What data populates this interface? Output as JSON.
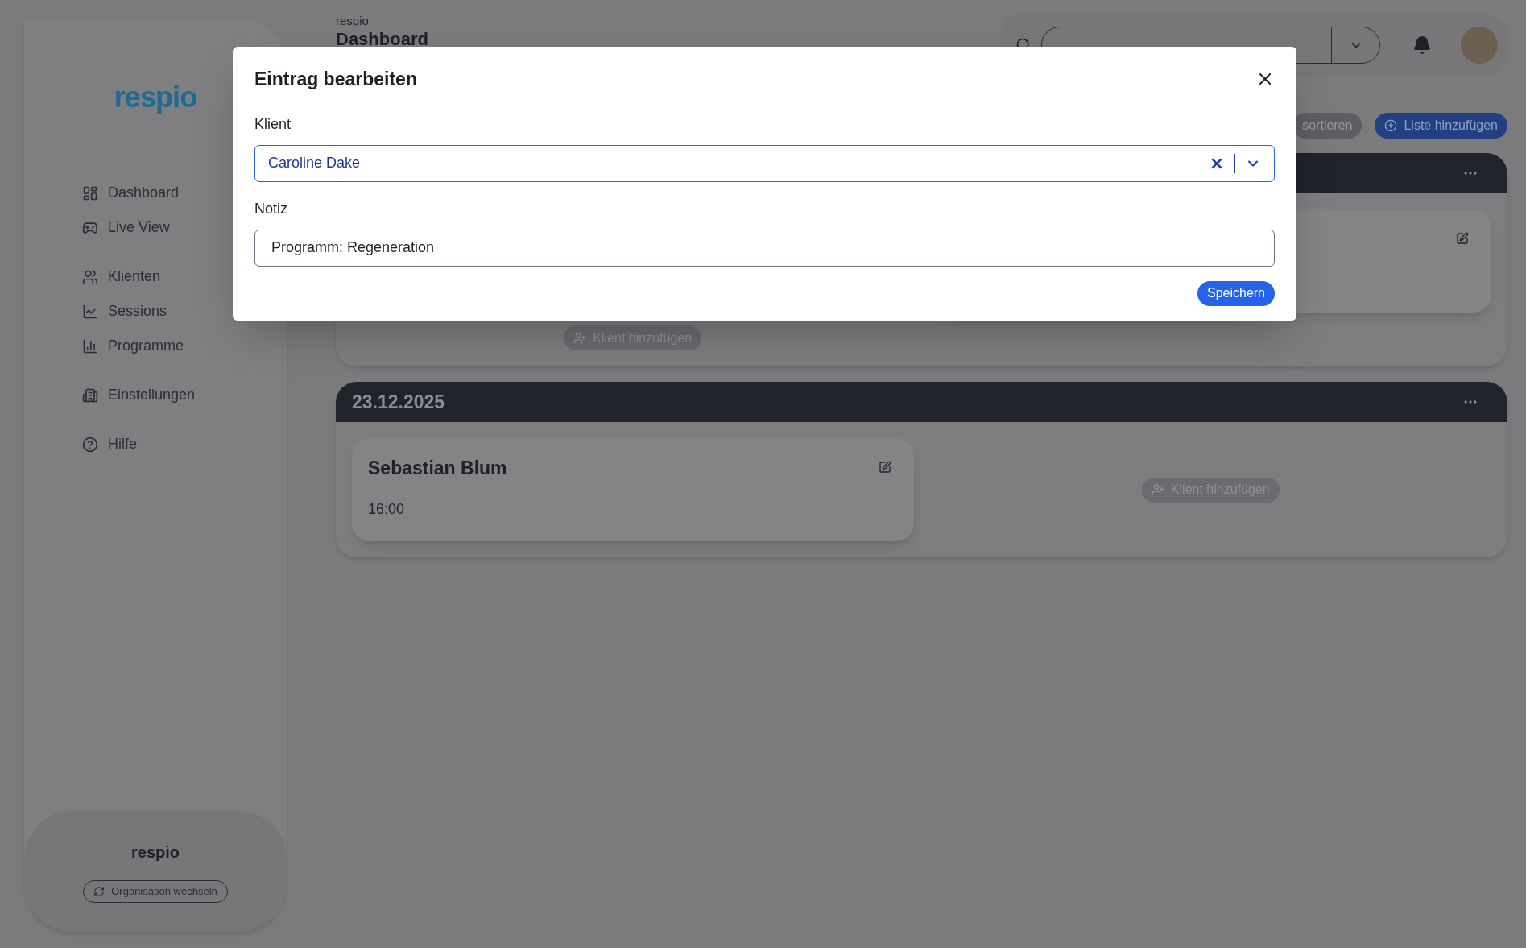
{
  "sidebar": {
    "logo": {
      "text": "respio"
    },
    "nav_groups": [
      [
        {
          "label": "Dashboard"
        },
        {
          "label": "Live View"
        }
      ],
      [
        {
          "label": "Klienten"
        },
        {
          "label": "Sessions"
        },
        {
          "label": "Programme"
        }
      ],
      [
        {
          "label": "Einstellungen"
        }
      ],
      [
        {
          "label": "Hilfe"
        }
      ]
    ],
    "organization": {
      "name": "respio",
      "switch_button": "Organisation wechseln"
    }
  },
  "header": {
    "breadcrumb": "respio",
    "title": "Dashboard"
  },
  "toolbar": {
    "buttons": [
      {
        "label": "sortieren",
        "kind": "secondary"
      },
      {
        "label": "Liste hinzufügen",
        "kind": "primary"
      }
    ]
  },
  "lists": [
    {
      "entries": [
        {
          "editable": true
        }
      ],
      "add_button": "Klient hinzufügen"
    },
    {
      "date": "23.12.2025",
      "entries": [
        {
          "name": "Sebastian Blum",
          "time": "16:00",
          "editable": true
        }
      ],
      "add_button": "Klient hinzufügen"
    }
  ],
  "dialog": {
    "title": "Eintrag bearbeiten",
    "fields": [
      {
        "label": "Klient",
        "kind": "select",
        "value": "Caroline Dake",
        "focused": true
      },
      {
        "label": "Notiz",
        "kind": "text",
        "value": "Programm: Regeneration",
        "focused": false
      }
    ],
    "submit": "Speichern"
  }
}
